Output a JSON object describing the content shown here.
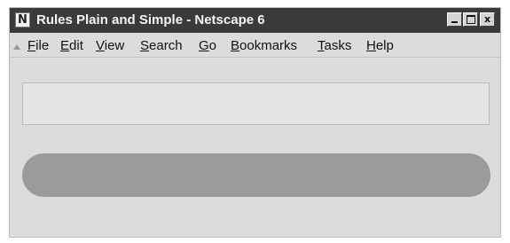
{
  "window": {
    "title": "Rules Plain and Simple - Netscape 6",
    "app_icon_letter": "N"
  },
  "menu": {
    "items": [
      {
        "label": "File"
      },
      {
        "label": "Edit"
      },
      {
        "label": "View"
      },
      {
        "label": "Search"
      },
      {
        "label": "Go"
      },
      {
        "label": "Bookmarks"
      },
      {
        "label": "Tasks"
      },
      {
        "label": "Help"
      }
    ]
  },
  "window_controls": {
    "minimize_icon": "minimize-icon",
    "maximize_icon": "maximize-icon",
    "close_icon": "close-icon",
    "close_glyph": "x"
  },
  "colors": {
    "titlebar": "#3a3a3a",
    "window_bg": "#dcdcdc",
    "pill": "#9b9b9b"
  }
}
